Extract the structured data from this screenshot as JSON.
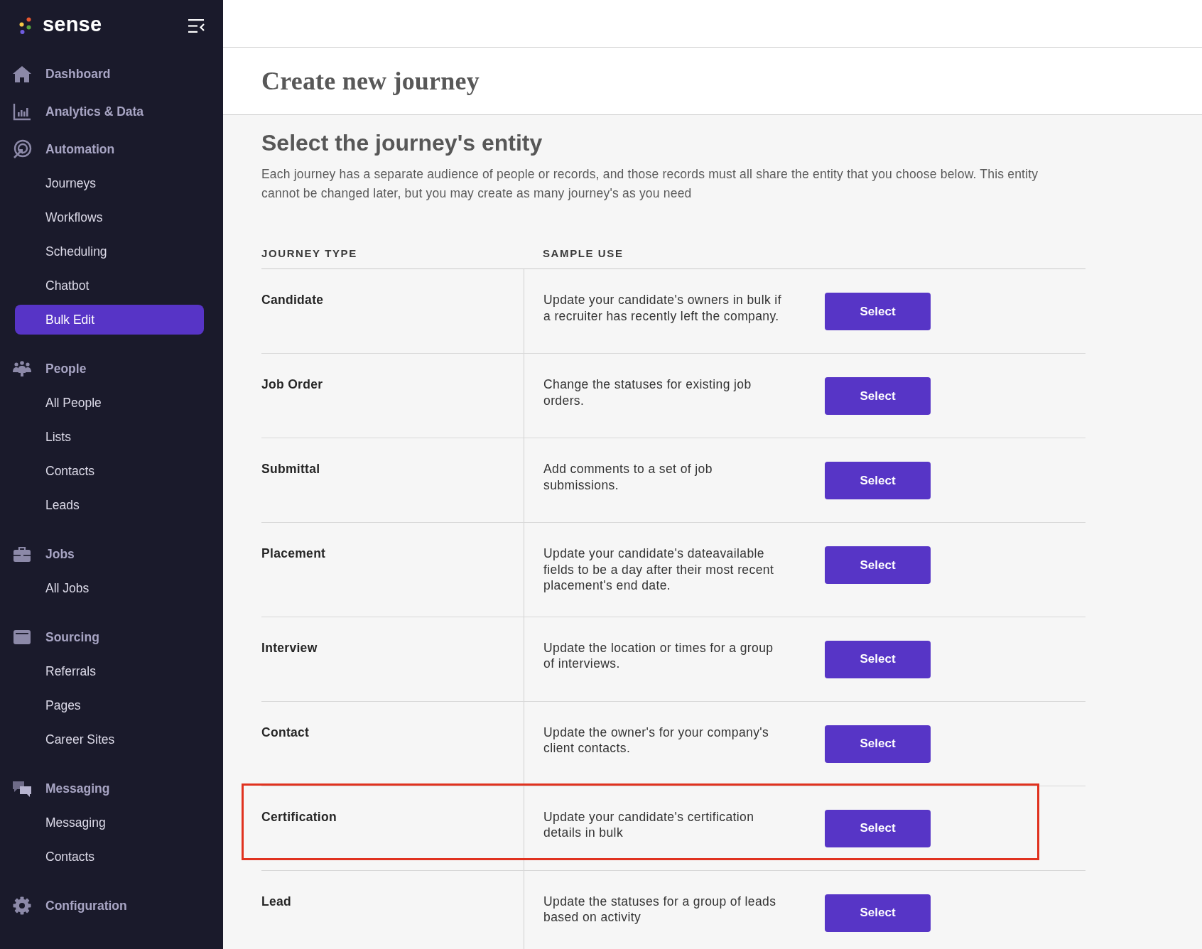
{
  "sidebar": {
    "logo": "sense",
    "groups": [
      {
        "label": "Dashboard",
        "selected": false
      },
      {
        "label": "Analytics & Data",
        "selected": false
      },
      {
        "label": "Automation",
        "selected": false,
        "items": [
          {
            "label": "Journeys",
            "selected": false
          },
          {
            "label": "Workflows",
            "selected": false
          },
          {
            "label": "Scheduling",
            "selected": false
          },
          {
            "label": "Chatbot",
            "selected": false
          },
          {
            "label": "Bulk Edit",
            "selected": true
          }
        ]
      },
      {
        "label": "People",
        "selected": false,
        "items": [
          {
            "label": "All People",
            "selected": false
          },
          {
            "label": "Lists",
            "selected": false
          },
          {
            "label": "Contacts",
            "selected": false
          },
          {
            "label": "Leads",
            "selected": false
          }
        ]
      },
      {
        "label": "Jobs",
        "selected": false,
        "items": [
          {
            "label": "All Jobs",
            "selected": false
          }
        ]
      },
      {
        "label": "Sourcing",
        "selected": false,
        "items": [
          {
            "label": "Referrals",
            "selected": false
          },
          {
            "label": "Pages",
            "selected": false
          },
          {
            "label": "Career Sites",
            "selected": false
          }
        ]
      },
      {
        "label": "Messaging",
        "selected": false,
        "items": [
          {
            "label": "Messaging",
            "selected": false
          },
          {
            "label": "Contacts",
            "selected": false
          }
        ]
      },
      {
        "label": "Configuration",
        "selected": false
      }
    ]
  },
  "page": {
    "title": "Create new journey"
  },
  "section": {
    "heading": "Select the journey's entity",
    "description": "Each journey has a separate audience of people or records, and those records must all share the entity that you choose below. This entity cannot be changed later, but you may create as many journey's as you need"
  },
  "table": {
    "columns": [
      "JOURNEY TYPE",
      "SAMPLE USE"
    ],
    "rows": [
      {
        "journey_type": "Candidate",
        "sample_use": "Update your candidate's owners in bulk if a recruiter has recently left the company.",
        "button": "Select",
        "highlighted": false
      },
      {
        "journey_type": "Job Order",
        "sample_use": "Change the statuses for existing job orders.",
        "button": "Select",
        "highlighted": false
      },
      {
        "journey_type": "Submittal",
        "sample_use": "Add comments to a set of job submissions.",
        "button": "Select",
        "highlighted": false
      },
      {
        "journey_type": "Placement",
        "sample_use": "Update your candidate's dateavailable fields to be a day after their most recent placement's end date.",
        "button": "Select",
        "highlighted": false
      },
      {
        "journey_type": "Interview",
        "sample_use": "Update the location or times for a group of interviews.",
        "button": "Select",
        "highlighted": false
      },
      {
        "journey_type": "Contact",
        "sample_use": "Update the owner's for your company's client contacts.",
        "button": "Select",
        "highlighted": false
      },
      {
        "journey_type": "Certification",
        "sample_use": "Update your candidate's certification details in bulk",
        "button": "Select",
        "highlighted": true
      },
      {
        "journey_type": "Lead",
        "sample_use": "Update the statuses for a group of leads based on activity",
        "button": "Select",
        "highlighted": false
      }
    ]
  }
}
